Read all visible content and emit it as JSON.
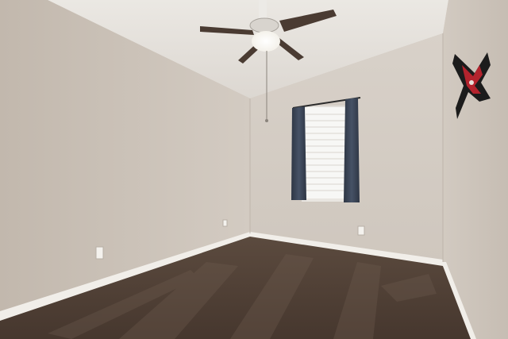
{
  "scene": {
    "subject": "empty-room",
    "fixtures": [
      "ceiling-fan",
      "window",
      "curtains",
      "window-blinds",
      "wall-art",
      "electrical-outlet",
      "carpet",
      "baseboard"
    ]
  },
  "colors": {
    "wall_left": "#c9c0b6",
    "wall_back": "#d4ccc3",
    "wall_right": "#cfc6bc",
    "ceiling": "#e6e2dc",
    "carpet": "#4f3f34",
    "curtain": "#3d4757",
    "baseboard": "#f1eee9",
    "art_red": "#b3232d",
    "art_black": "#1c1c1c"
  }
}
